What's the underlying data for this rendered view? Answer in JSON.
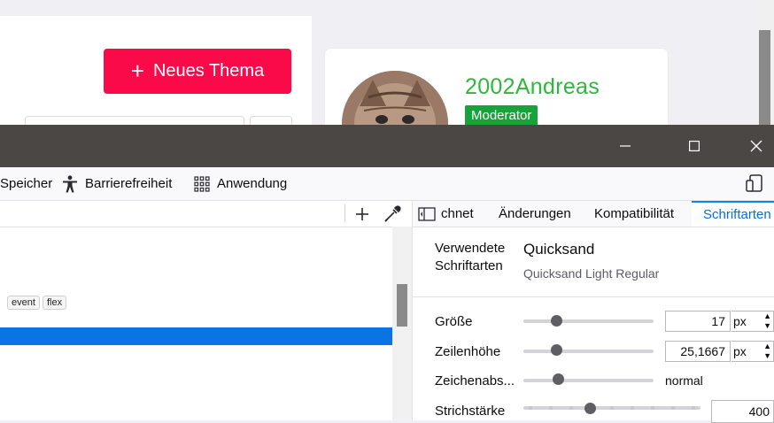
{
  "webpage": {
    "new_topic_label": "Neues Thema",
    "username": "2002Andreas",
    "role": "Moderator",
    "colors": {
      "accent_button": "#fb0a4a",
      "username": "#2db83d",
      "badge": "#17a23a"
    }
  },
  "window": {
    "minimize_icon": "minimize-icon",
    "maximize_icon": "maximize-icon",
    "close_icon": "close-icon"
  },
  "toolbar": {
    "tabs": [
      {
        "label": "Speicher",
        "icon": "none"
      },
      {
        "label": "Barrierefreiheit",
        "icon": "accessibility-icon"
      },
      {
        "label": "Anwendung",
        "icon": "grid-icon"
      }
    ]
  },
  "inspector": {
    "badges": [
      "event",
      "flex"
    ]
  },
  "sidebar": {
    "tabs": [
      {
        "label": "chnet",
        "icon": "layout-icon"
      },
      {
        "label": "Änderungen"
      },
      {
        "label": "Kompatibilität"
      },
      {
        "label": "Schriftarten",
        "active": true
      }
    ],
    "used_fonts_label": "Verwendete Schriftarten",
    "font_name": "Quicksand",
    "font_variant": "Quicksand Light Regular",
    "properties": {
      "size": {
        "label": "Größe",
        "value": "17",
        "unit": "px"
      },
      "line_height": {
        "label": "Zeilenhöhe",
        "value": "25,1667",
        "unit": "px"
      },
      "letter_spacing": {
        "label": "Zeichenabs...",
        "value": "normal"
      },
      "weight": {
        "label": "Strichstärke",
        "value": "400"
      }
    }
  }
}
